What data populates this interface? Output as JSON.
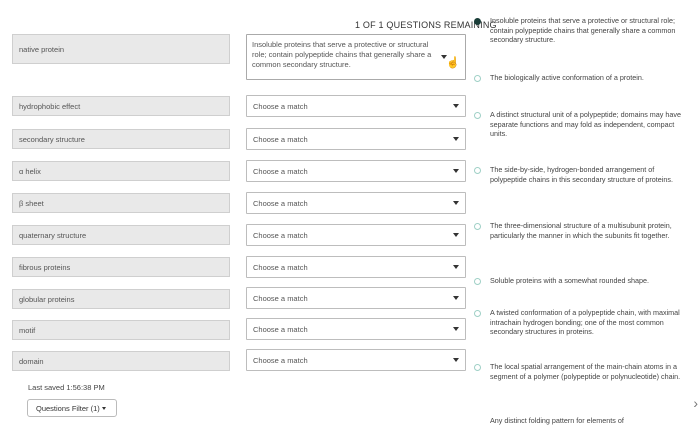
{
  "header": {
    "remaining": "1 OF 1 QUESTIONS REMAINING"
  },
  "terms": [
    "native protein",
    "hydrophobic effect",
    "secondary structure",
    "α helix",
    "β sheet",
    "quaternary structure",
    "fibrous proteins",
    "globular proteins",
    "motif",
    "domain"
  ],
  "selects": [
    "Insoluble proteins that serve a protective or structural role; contain polypeptide chains that generally share a common secondary structure.",
    "Choose a match",
    "Choose a match",
    "Choose a match",
    "Choose a match",
    "Choose a match",
    "Choose a match",
    "Choose a match",
    "Choose a match",
    "Choose a match"
  ],
  "options": [
    {
      "text": "Insoluble proteins that serve a protective or structural role; contain polypeptide chains that generally share a common secondary structure.",
      "selected": true
    },
    {
      "text": "The biologically active conformation of a protein.",
      "selected": false
    },
    {
      "text": "A distinct structural unit of a polypeptide; domains may have separate functions and may fold as independent, compact units.",
      "selected": false
    },
    {
      "text": "The side-by-side, hydrogen-bonded arrangement of polypeptide chains in this secondary structure of proteins.",
      "selected": false
    },
    {
      "text": "The three-dimensional structure of a multisubunit protein, particularly the manner in which the subunits fit together.",
      "selected": false
    },
    {
      "text": "Soluble proteins with a somewhat rounded shape.",
      "selected": false
    },
    {
      "text": "A twisted conformation of a polypeptide chain, with maximal intrachain hydrogen bonding; one of the most common secondary structures in proteins.",
      "selected": false
    },
    {
      "text": "The local spatial arrangement of the main-chain atoms in a segment of a polymer (polypeptide or polynucleotide) chain.",
      "selected": false
    },
    {
      "text": "Any distinct folding pattern for elements of",
      "selected": false
    }
  ],
  "footer": {
    "last_saved": "Last saved 1:56:38 PM",
    "filter_label": "Questions Filter (1)"
  }
}
